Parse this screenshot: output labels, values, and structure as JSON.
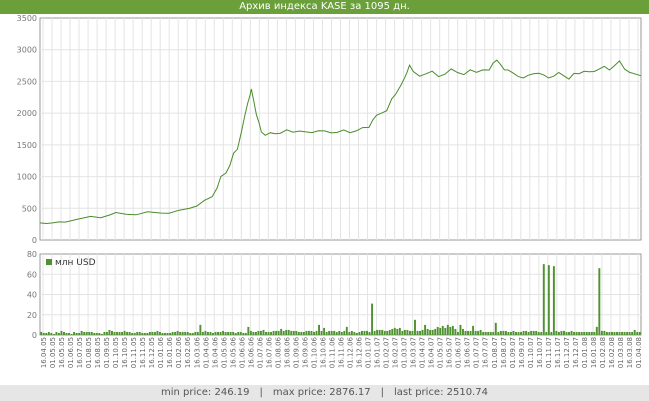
{
  "title": "Архив индекса KASE за 1095 дн.",
  "footer": {
    "min_label": "min price: 246.19",
    "max_label": "max price: 2876.17",
    "last_label": "last price: 2510.74",
    "separator": "|"
  },
  "colors": {
    "accent": "#6a9f3a",
    "line": "#4a8c2a",
    "bar": "#4f9330",
    "grid": "#e4e4e4"
  },
  "chart_data": [
    {
      "type": "line",
      "series": [
        {
          "values": [
            [
              0,
              270
            ],
            [
              5,
              260
            ],
            [
              10,
              270
            ],
            [
              15,
              285
            ],
            [
              20,
              300
            ],
            [
              30,
              330
            ],
            [
              40,
              360
            ],
            [
              48,
              375
            ],
            [
              55,
              400
            ],
            [
              60,
              415
            ],
            [
              68,
              405
            ],
            [
              76,
              410
            ],
            [
              85,
              420
            ],
            [
              96,
              430
            ],
            [
              102,
              440
            ],
            [
              110,
              470
            ],
            [
              118,
              510
            ],
            [
              124,
              560
            ],
            [
              130,
              620
            ],
            [
              136,
              700
            ],
            [
              140,
              820
            ],
            [
              143,
              990
            ],
            [
              147,
              1080
            ],
            [
              150,
              1180
            ],
            [
              153,
              1350
            ],
            [
              156,
              1430
            ],
            [
              159,
              1700
            ],
            [
              162,
              1950
            ],
            [
              164,
              2150
            ],
            [
              166,
              2300
            ],
            [
              167,
              2380
            ],
            [
              169,
              2200
            ],
            [
              171,
              2000
            ],
            [
              173,
              1850
            ],
            [
              175,
              1720
            ],
            [
              178,
              1650
            ],
            [
              182,
              1680
            ],
            [
              186,
              1700
            ],
            [
              190,
              1690
            ],
            [
              195,
              1720
            ],
            [
              200,
              1700
            ],
            [
              205,
              1730
            ],
            [
              210,
              1680
            ],
            [
              215,
              1700
            ],
            [
              220,
              1740
            ],
            [
              225,
              1720
            ],
            [
              230,
              1700
            ],
            [
              235,
              1720
            ],
            [
              240,
              1730
            ],
            [
              245,
              1710
            ],
            [
              250,
              1720
            ],
            [
              255,
              1760
            ],
            [
              260,
              1800
            ],
            [
              263,
              1900
            ],
            [
              266,
              1950
            ],
            [
              270,
              2000
            ],
            [
              274,
              2050
            ],
            [
              278,
              2200
            ],
            [
              281,
              2300
            ],
            [
              285,
              2450
            ],
            [
              288,
              2550
            ],
            [
              290,
              2650
            ],
            [
              292,
              2780
            ],
            [
              295,
              2650
            ],
            [
              300,
              2600
            ],
            [
              305,
              2620
            ],
            [
              310,
              2650
            ],
            [
              315,
              2600
            ],
            [
              320,
              2620
            ],
            [
              325,
              2680
            ],
            [
              330,
              2640
            ],
            [
              335,
              2620
            ],
            [
              340,
              2660
            ],
            [
              345,
              2650
            ],
            [
              350,
              2700
            ],
            [
              355,
              2680
            ],
            [
              358,
              2800
            ],
            [
              361,
              2860
            ],
            [
              364,
              2760
            ],
            [
              367,
              2700
            ],
            [
              370,
              2680
            ],
            [
              374,
              2620
            ],
            [
              378,
              2600
            ],
            [
              382,
              2560
            ],
            [
              386,
              2580
            ],
            [
              390,
              2620
            ],
            [
              394,
              2640
            ],
            [
              398,
              2580
            ],
            [
              402,
              2560
            ],
            [
              406,
              2600
            ],
            [
              410,
              2640
            ],
            [
              414,
              2600
            ],
            [
              418,
              2560
            ],
            [
              422,
              2620
            ],
            [
              426,
              2640
            ],
            [
              430,
              2660
            ],
            [
              434,
              2640
            ],
            [
              438,
              2680
            ],
            [
              442,
              2700
            ],
            [
              446,
              2720
            ],
            [
              450,
              2680
            ],
            [
              454,
              2760
            ],
            [
              458,
              2800
            ],
            [
              462,
              2700
            ],
            [
              466,
              2660
            ],
            [
              470,
              2620
            ],
            [
              475,
              2600
            ]
          ]
        }
      ],
      "ylim": [
        0,
        3500
      ],
      "yticks": [
        "0",
        "500",
        "1000",
        "1500",
        "2000",
        "2500",
        "3000",
        "3500"
      ],
      "grid": true
    },
    {
      "type": "bar",
      "legend": "млн USD",
      "ylim": [
        0,
        80
      ],
      "yticks": [
        "0",
        "20",
        "40",
        "60",
        "80"
      ],
      "values": [
        3,
        2,
        2,
        3,
        2,
        1,
        3,
        2,
        4,
        3,
        2,
        2,
        1,
        3,
        2,
        2,
        4,
        3,
        3,
        3,
        3,
        2,
        2,
        2,
        1,
        3,
        3,
        5,
        4,
        3,
        3,
        3,
        3,
        4,
        3,
        3,
        2,
        2,
        3,
        3,
        2,
        2,
        2,
        3,
        3,
        3,
        4,
        3,
        2,
        2,
        2,
        2,
        3,
        3,
        4,
        3,
        3,
        3,
        3,
        2,
        2,
        3,
        3,
        3,
        3,
        4,
        3,
        3,
        2,
        3,
        3,
        3,
        4,
        3,
        3,
        3,
        3,
        2,
        3,
        3,
        2,
        2,
        3,
        4,
        3,
        3,
        4,
        4,
        5,
        3,
        3,
        3,
        4,
        4,
        4,
        4,
        4,
        5,
        5,
        4,
        4,
        4,
        3,
        3,
        3,
        4,
        4,
        4,
        3,
        4,
        10,
        4,
        7,
        3,
        4,
        4,
        4,
        3,
        4,
        3,
        4,
        4,
        3,
        4,
        3,
        2,
        3,
        4,
        4,
        4,
        3,
        4,
        4,
        5,
        5,
        5,
        4,
        4,
        5,
        6,
        7,
        6,
        7,
        4,
        5,
        5,
        4,
        4,
        3,
        4,
        4,
        5,
        7,
        6,
        8,
        5,
        6,
        8,
        7,
        9,
        7,
        10,
        8,
        9,
        6,
        3,
        4,
        6,
        4,
        4,
        4,
        5,
        4,
        4,
        5,
        3,
        3,
        3,
        3,
        3,
        4,
        3,
        4,
        4,
        4,
        3,
        3,
        4,
        3,
        3,
        3,
        4,
        4,
        3,
        4,
        4,
        4,
        3,
        3,
        3,
        3,
        3,
        3,
        4,
        4,
        3,
        4,
        4,
        3,
        3,
        4,
        3,
        3,
        3,
        3,
        3,
        3,
        3,
        3,
        3,
        2,
        3,
        4,
        4,
        3,
        3,
        3,
        3,
        3,
        3,
        3,
        3,
        3,
        3,
        3,
        3,
        3,
        3
      ],
      "spikes": [
        [
          63,
          10
        ],
        [
          82,
          8
        ],
        [
          95,
          6
        ],
        [
          131,
          31
        ],
        [
          148,
          15
        ],
        [
          152,
          10
        ],
        [
          154,
          5
        ],
        [
          199,
          70
        ],
        [
          201,
          69
        ],
        [
          203,
          68
        ],
        [
          221,
          66
        ],
        [
          220,
          8
        ],
        [
          121,
          8
        ],
        [
          171,
          9
        ],
        [
          166,
          10
        ],
        [
          180,
          12
        ],
        [
          235,
          5
        ],
        [
          246,
          6
        ]
      ],
      "xticks": [
        "16.04.05",
        "01.05.05",
        "16.05.05",
        "01.06.05",
        "16.07.05",
        "01.08.05",
        "16.08.05",
        "01.09.05",
        "01.10.05",
        "16.10.05",
        "01.11.05",
        "16.11.05",
        "16.12.05",
        "01.01.06",
        "16.01.06",
        "01.02.06",
        "16.02.06",
        "16.03.06",
        "01.04.06",
        "16.04.06",
        "01.05.06",
        "16.05.06",
        "01.06.06",
        "16.06.06",
        "01.07.06",
        "16.07.06",
        "01.08.06",
        "16.08.06",
        "01.09.06",
        "16.09.06",
        "01.10.06",
        "16.10.06",
        "01.11.06",
        "16.11.06",
        "01.12.06",
        "16.12.06",
        "01.01.07",
        "16.01.07",
        "01.02.07",
        "16.02.07",
        "01.03.07",
        "16.03.07",
        "01.04.07",
        "16.04.07",
        "01.05.07",
        "16.05.07",
        "01.06.07",
        "16.06.07",
        "01.07.07",
        "16.07.07",
        "01.08.07",
        "16.08.07",
        "01.09.07",
        "16.09.07",
        "01.10.07",
        "16.10.07",
        "01.11.07",
        "16.11.07",
        "01.12.07",
        "16.12.07",
        "01.01.08",
        "16.01.08",
        "01.02.08",
        "16.02.08",
        "01.03.08",
        "16.03.08",
        "01.04.08"
      ],
      "grid": true
    }
  ]
}
